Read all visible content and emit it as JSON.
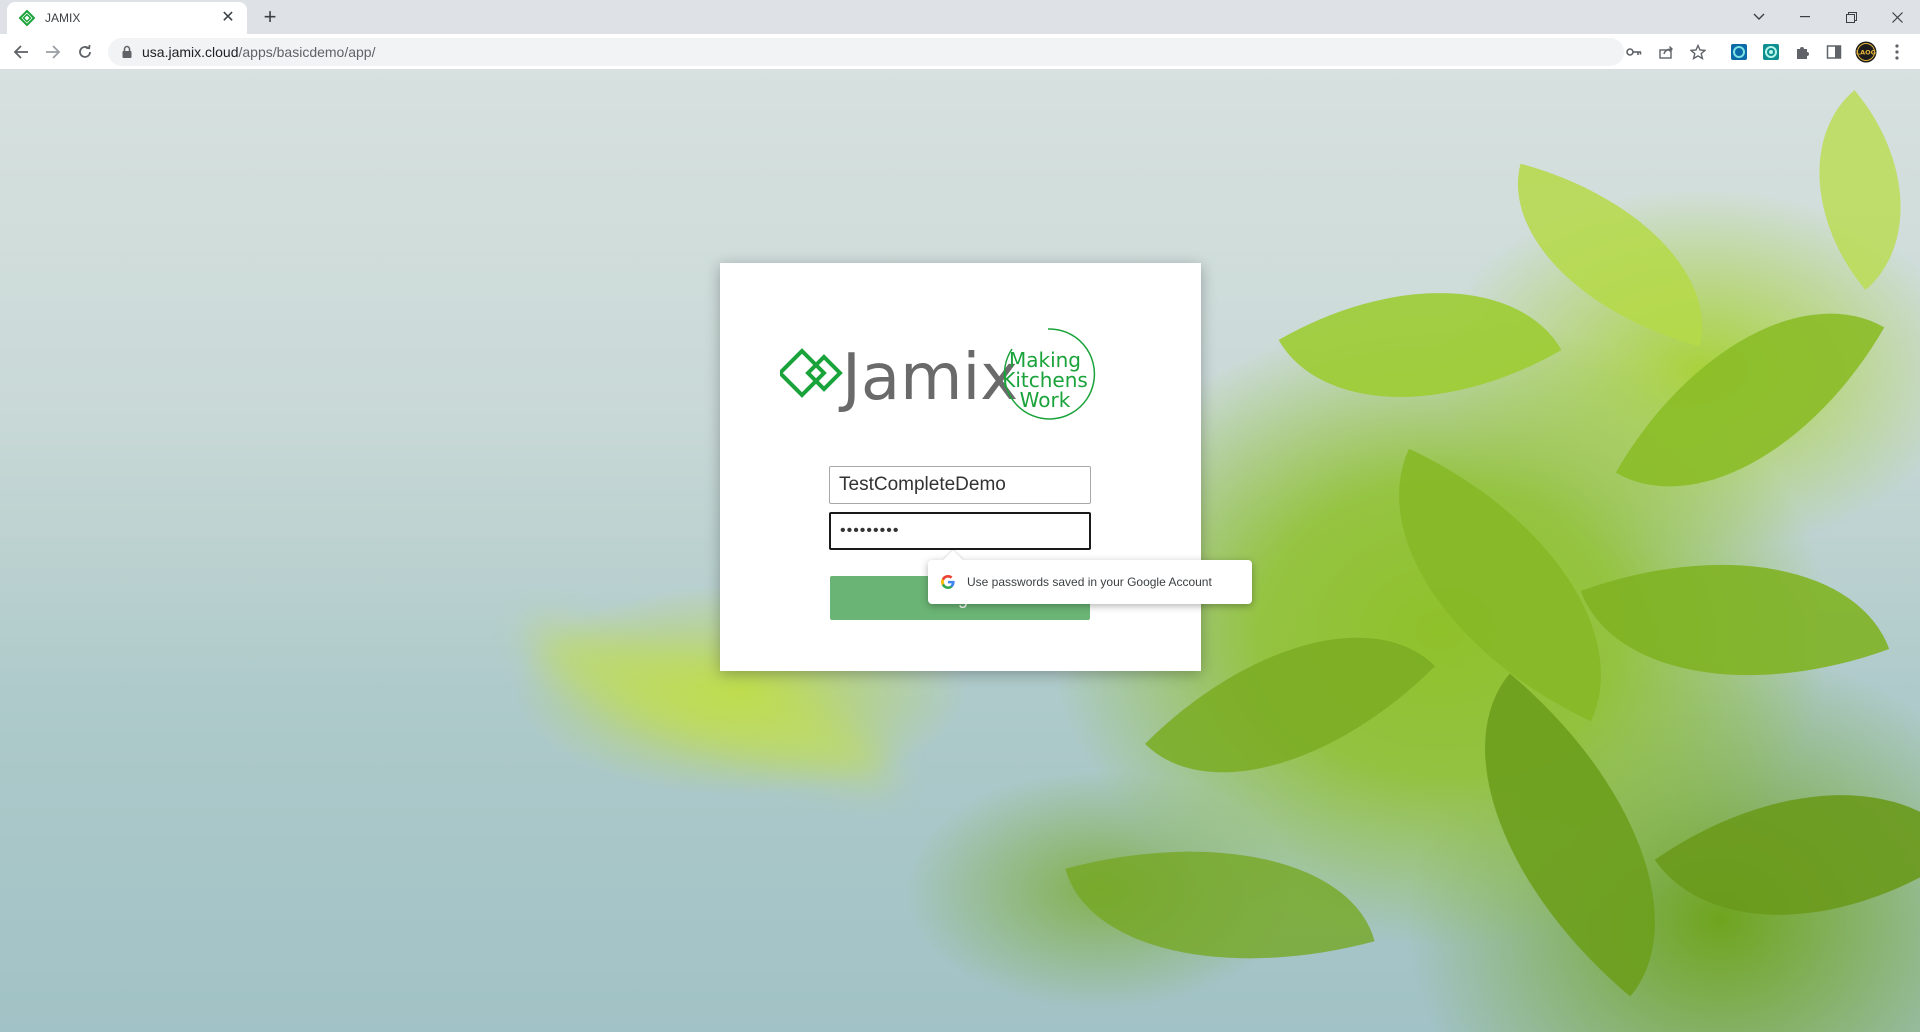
{
  "browser": {
    "tab": {
      "title": "JAMIX",
      "favicon_icon": "jamix-logo-icon",
      "close_glyph": "✕"
    },
    "new_tab_glyph": "+",
    "window_controls": [
      "⌄",
      "—",
      "❐",
      "✕"
    ],
    "address_bar": {
      "host": "usa.jamix.cloud",
      "path": "/apps/basicdemo/app/"
    },
    "toolbar_icons": [
      "back-icon",
      "forward-icon",
      "reload-icon",
      "lock-icon",
      "key-icon",
      "share-icon",
      "bookmark-star-icon",
      "extension-1-icon",
      "extension-2-icon",
      "extensions-puzzle-icon",
      "side-panel-icon",
      "profile-avatar-icon",
      "menu-kebab-icon"
    ],
    "profile_avatar_text": "LAOG"
  },
  "login": {
    "brand": "Jamix",
    "tagline_lines": [
      "Making",
      "Kitchens",
      "Work"
    ],
    "username_value": "TestCompleteDemo",
    "password_value": "•••••••••",
    "login_button_label": "Login",
    "brand_color": "#1aa33a",
    "button_color": "#6ab475"
  },
  "password_popup": {
    "text": "Use passwords saved in your Google Account",
    "icon": "google-g-icon"
  }
}
